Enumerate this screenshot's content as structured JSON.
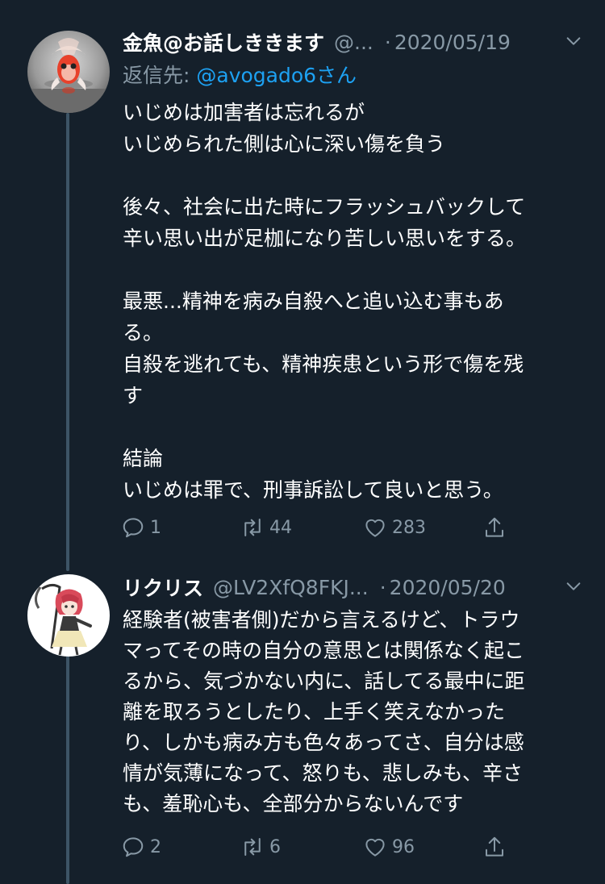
{
  "tweets": [
    {
      "name": "金魚@お話しききます",
      "handle": "@...",
      "separator": "·",
      "date": "2020/05/19",
      "reply_prefix": "返信先: ",
      "reply_mention": "@avogado6",
      "reply_suffix": "さん",
      "lines": [
        "いじめは加害者は忘れるが",
        "いじめられた側は心に深い傷を負う",
        "",
        "後々、社会に出た時にフラッシュバックして",
        "辛い思い出が足枷になり苦しい思いをする。",
        "",
        "最悪...精神を病み自殺へと追い込む事もあ",
        "る。",
        "自殺を逃れても、精神疾患という形で傷を残",
        "す",
        "",
        "結論",
        "いじめは罪で、刑事訴訟して良いと思う。"
      ],
      "replies": "1",
      "retweets": "44",
      "likes": "283",
      "icons": {
        "reply": "reply-icon",
        "retweet": "retweet-icon",
        "like": "heart-icon",
        "share": "share-icon",
        "menu": "chevron-down-icon"
      }
    },
    {
      "name": "リクリス",
      "handle": "@LV2XfQ8FKJ...",
      "separator": "·",
      "date": "2020/05/20",
      "lines": [
        "経験者(被害者側)だから言えるけど、トラウ",
        "マってその時の自分の意思とは関係なく起こ",
        "るから、気づかない内に、話してる最中に距",
        "離を取ろうとしたり、上手く笑えなかった",
        "り、しかも病み方も色々あってさ、自分は感",
        "情が気薄になって、怒りも、悲しみも、辛さ",
        "も、羞恥心も、全部分からないんです"
      ],
      "replies": "2",
      "retweets": "6",
      "likes": "96"
    }
  ],
  "colors": {
    "background": "#15202b",
    "text": "#ffffff",
    "secondary": "#8899a6",
    "link": "#1da1f2",
    "thread_line": "#3d5466"
  }
}
